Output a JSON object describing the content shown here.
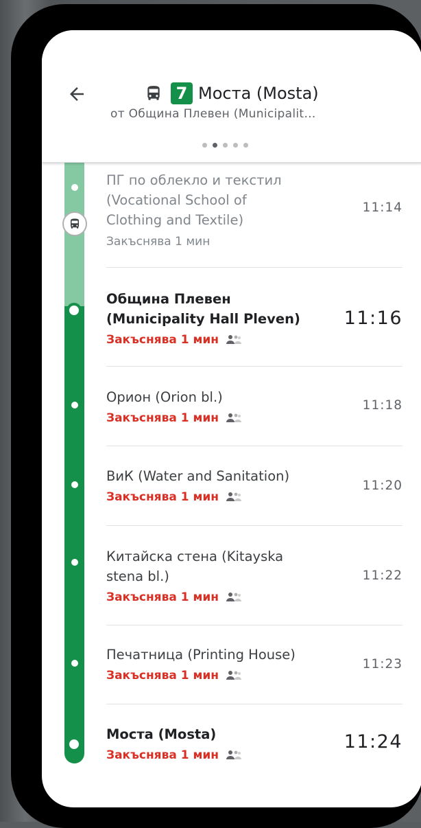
{
  "header": {
    "route_number": "7",
    "title": "Моста (Mosta)",
    "subtitle": "от Община Плевен (Municipalit…",
    "pager_dots": 5,
    "pager_active": 1
  },
  "stops": [
    {
      "name": "ПГ по облекло и текстил (Vocational School of Clothing and Textile)",
      "name_lines": [
        "ПГ по облекло и текстил",
        "(Vocational School of",
        "Clothing and Textile)"
      ],
      "delay": "Закъснява 1 мин",
      "time": "11:14",
      "passed": true
    },
    {
      "name_lines": [
        "Община Плевен",
        "(Municipality Hall Pleven)"
      ],
      "delay": "Закъснява 1 мин",
      "time": "11:16",
      "highlight": true
    },
    {
      "name_lines": [
        "Орион (Orion bl.)"
      ],
      "delay": "Закъснява 1 мин",
      "time": "11:18"
    },
    {
      "name_lines": [
        "ВиК (Water and Sanitation)"
      ],
      "delay": "Закъснява 1 мин",
      "time": "11:20"
    },
    {
      "name_lines": [
        "Китайска стена (Kitayska",
        "stena bl.)"
      ],
      "delay": "Закъснява 1 мин",
      "time": "11:22"
    },
    {
      "name_lines": [
        "Печатница (Printing House)"
      ],
      "delay": "Закъснява 1 мин",
      "time": "11:23"
    },
    {
      "name_lines": [
        "Моста (Mosta)"
      ],
      "delay": "Закъснява 1 мин",
      "time": "11:24",
      "highlight": true
    }
  ],
  "colors": {
    "route_green": "#15904a",
    "passed_green": "#84c9a1",
    "delay_red": "#d93025"
  },
  "icons": {
    "back": "arrow-left-icon",
    "bus": "bus-icon",
    "crowd": "people-crowd-icon"
  }
}
